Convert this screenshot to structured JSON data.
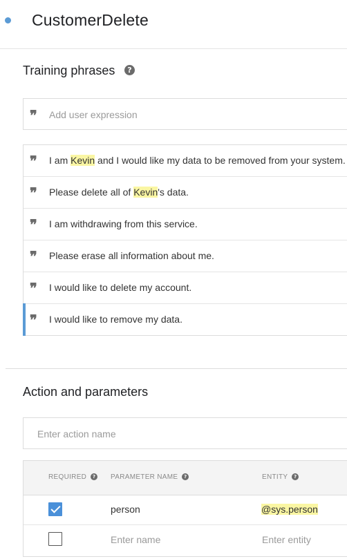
{
  "intent": {
    "name": "CustomerDelete",
    "status_color": "#5b9bd5"
  },
  "training": {
    "title": "Training phrases",
    "help_icon": "question-circle-icon",
    "add_placeholder": "Add user expression",
    "quote_icon": "quote-icon",
    "highlight_color": "#faf6a3",
    "phrases": [
      {
        "before": "I am ",
        "entity": "Kevin",
        "after": " and I would like my data to be removed from your system."
      },
      {
        "before": "Please delete all of ",
        "entity": "Kevin",
        "after": "'s data."
      },
      {
        "before": "I am withdrawing from this service.",
        "entity": "",
        "after": ""
      },
      {
        "before": "Please erase all information about me.",
        "entity": "",
        "after": ""
      },
      {
        "before": "I would like to delete my account.",
        "entity": "",
        "after": ""
      },
      {
        "before": "I would like to remove my data.",
        "entity": "",
        "after": ""
      }
    ]
  },
  "action": {
    "title": "Action and parameters",
    "action_placeholder": "Enter action name",
    "columns": {
      "required": "REQUIRED",
      "parameter_name": "PARAMETER NAME",
      "entity": "ENTITY"
    },
    "rows": [
      {
        "required": true,
        "name": "person",
        "entity": "@sys.person"
      }
    ],
    "new_row": {
      "required": false,
      "name_placeholder": "Enter name",
      "entity_placeholder": "Enter entity"
    }
  }
}
